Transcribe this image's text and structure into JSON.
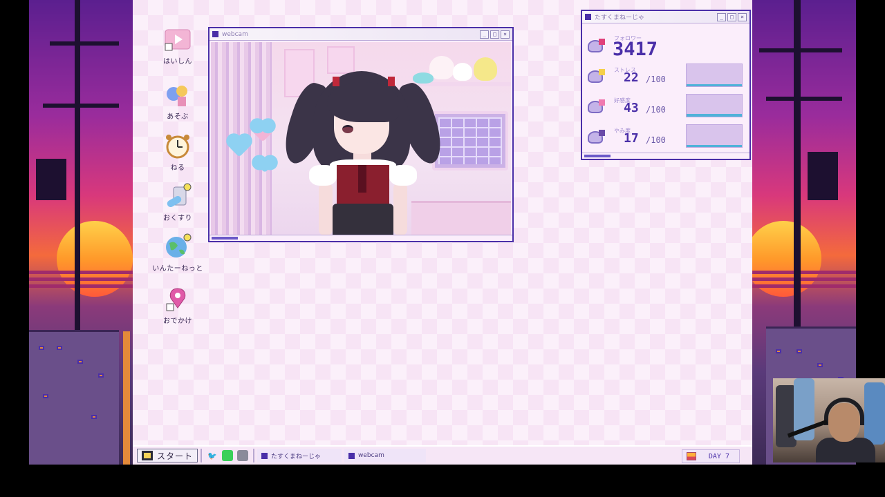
{
  "desktop_icons": [
    {
      "label": "はいしん",
      "icon": "play-icon"
    },
    {
      "label": "あそぶ",
      "icon": "game-icon"
    },
    {
      "label": "ねる",
      "icon": "alarm-clock-icon"
    },
    {
      "label": "おくすり",
      "icon": "pills-icon"
    },
    {
      "label": "いんたーねっと",
      "icon": "globe-icon"
    },
    {
      "label": "おでかけ",
      "icon": "map-pin-icon"
    }
  ],
  "webcam_window": {
    "title": "webcam"
  },
  "stats_window": {
    "title": "たすくまねーじゃ",
    "followers": {
      "label": "フォロワー",
      "value": "3417"
    },
    "stress": {
      "label": "ストレス",
      "value": "22",
      "max": "/100",
      "level": 0.22
    },
    "affection": {
      "label": "好感度",
      "value": "43",
      "max": "/100",
      "level": 0.43
    },
    "darkness": {
      "label": "やみ度",
      "value": "17",
      "max": "/100",
      "level": 0.17
    }
  },
  "taskbar": {
    "start_label": "スタート",
    "quick_icons": [
      "twitter-icon",
      "chat-icon",
      "monitor-icon"
    ],
    "tasks": [
      "たすくまねーじゃ",
      "webcam"
    ],
    "day_label": "DAY 7"
  },
  "colors": {
    "accent": "#4a2fa8",
    "desktop": "#f7e4f5",
    "gauge_fill": "#4fb2d9"
  }
}
